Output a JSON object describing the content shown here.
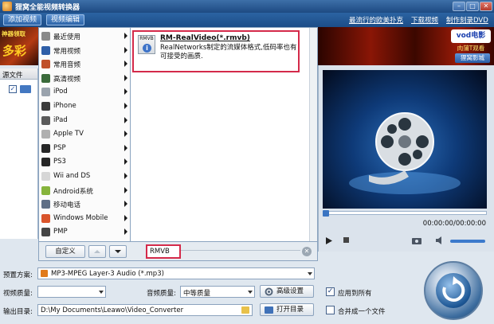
{
  "window": {
    "title": "狸窝全能视频转换器"
  },
  "toolbar": {
    "add_video": "添加视频",
    "edit_video": "视频编辑",
    "link_hot_drama": "最流行的欧美扑克",
    "link_download_video": "下载视频",
    "link_burn_dvd": "制作刻录DVD"
  },
  "ads": {
    "left_top": "神器领取",
    "left_big": "多彩",
    "right_logo": "vod电影",
    "right_sub": "肉蒲T观看",
    "right_btn": "狸窝影城"
  },
  "filelist": {
    "header": "源文件"
  },
  "menu": {
    "items": [
      {
        "label": "最近使用",
        "icon": "recent-icon",
        "color": "#8a8a8a"
      },
      {
        "label": "常用视频",
        "icon": "video-icon",
        "color": "#2f5fa8"
      },
      {
        "label": "常用音频",
        "icon": "audio-icon",
        "color": "#c0502a"
      },
      {
        "label": "高清视频",
        "icon": "hd-icon",
        "color": "#3a6a3a"
      },
      {
        "label": "iPod",
        "icon": "ipod-icon",
        "color": "#9aa3ad"
      },
      {
        "label": "iPhone",
        "icon": "iphone-icon",
        "color": "#3c3c3c"
      },
      {
        "label": "iPad",
        "icon": "ipad-icon",
        "color": "#5b5b5b"
      },
      {
        "label": "Apple TV",
        "icon": "apple-icon",
        "color": "#b0b0b0"
      },
      {
        "label": "PSP",
        "icon": "psp-icon",
        "color": "#262626"
      },
      {
        "label": "PS3",
        "icon": "ps3-icon",
        "color": "#262626"
      },
      {
        "label": "Wii and DS",
        "icon": "wii-icon",
        "color": "#d6d6d6"
      },
      {
        "label": "Android系统",
        "icon": "android-icon",
        "color": "#86b43c"
      },
      {
        "label": "移动电话",
        "icon": "phone-icon",
        "color": "#5f6f86"
      },
      {
        "label": "Windows Mobile",
        "icon": "windows-icon",
        "color": "#d9542b"
      },
      {
        "label": "PMP",
        "icon": "pmp-icon",
        "color": "#444444"
      }
    ]
  },
  "format_card": {
    "title": "RM-RealVideo(*.rmvb)",
    "description": "RealNetworks制定的流媒体格式,低码率也有可接受的画质.",
    "icon_label": "RMVB"
  },
  "popup_footer": {
    "custom_button": "自定义",
    "search_value": "RMVB"
  },
  "preview": {
    "time": "00:00:00/00:00:00",
    "progress": 0
  },
  "settings": {
    "preset_label": "预置方案:",
    "preset_value": "MP3-MPEG Layer-3 Audio (*.mp3)",
    "video_quality_label": "视频质量:",
    "video_quality_value": "",
    "audio_quality_label": "音频质量:",
    "audio_quality_value": "中等质量",
    "advanced_button": "高级设置",
    "apply_all_label": "应用到所有",
    "apply_all_checked": true,
    "output_label": "输出目录:",
    "output_value": "D:\\My Documents\\Leawo\\Video_Converter",
    "open_dir_button": "打开目录",
    "merge_label": "合并成一个文件",
    "merge_checked": false
  }
}
